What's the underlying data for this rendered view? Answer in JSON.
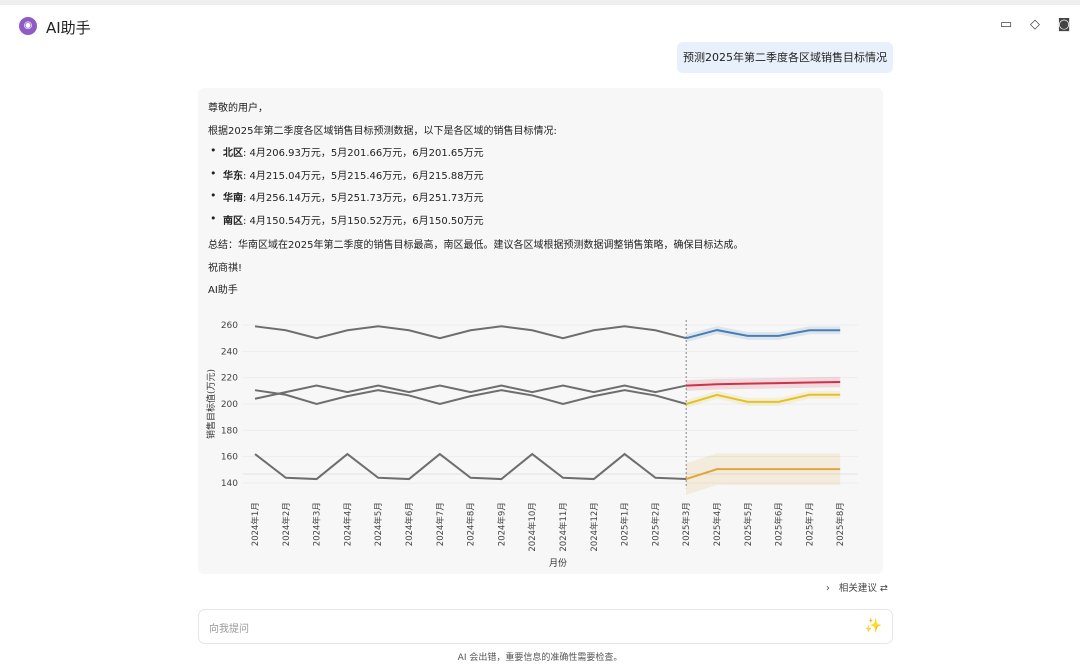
{
  "header": {
    "title": "AI助手",
    "logo_icon": "robot-icon",
    "icons": [
      "feedback-icon",
      "eraser-icon",
      "camera-icon"
    ]
  },
  "user_message": "预测2025年第二季度各区域销售目标情况",
  "answer": {
    "greeting": "尊敬的用户，",
    "intro": "根据2025年第二季度各区域销售目标预测数据，以下是各区域的销售目标情况:",
    "items": [
      {
        "region": "北区",
        "text": ": 4月206.93万元，5月201.66万元，6月201.65万元"
      },
      {
        "region": "华东",
        "text": ": 4月215.04万元，5月215.46万元，6月215.88万元"
      },
      {
        "region": "华南",
        "text": ": 4月256.14万元，5月251.73万元，6月251.73万元"
      },
      {
        "region": "南区",
        "text": ": 4月150.54万元，5月150.52万元，6月150.50万元"
      }
    ],
    "summary": "总结：华南区域在2025年第二季度的销售目标最高，南区最低。建议各区域根据预测数据调整销售策略，确保目标达成。",
    "closing": "祝商祺!",
    "signature": "AI助手"
  },
  "chart_data": {
    "type": "line",
    "xlabel": "月份",
    "ylabel": "销售目标值(万元)",
    "ylim": [
      130,
      265
    ],
    "yticks": [
      140,
      160,
      180,
      200,
      220,
      240,
      260
    ],
    "categories": [
      "2024年1月",
      "2024年2月",
      "2024年3月",
      "2024年4月",
      "2024年5月",
      "2024年6月",
      "2024年7月",
      "2024年8月",
      "2024年9月",
      "2024年10月",
      "2024年11月",
      "2024年12月",
      "2025年1月",
      "2025年2月",
      "2025年3月",
      "2025年4月",
      "2025年5月",
      "2025年6月",
      "2025年7月",
      "2025年8月"
    ],
    "forecast_start_index": 14,
    "series": [
      {
        "name": "华南",
        "history": [
          259,
          256,
          250,
          256,
          259,
          256,
          250,
          256,
          259,
          256,
          250,
          256,
          259,
          256,
          250
        ],
        "forecast": [
          250,
          256.14,
          251.73,
          251.73,
          256,
          256
        ],
        "band": 3,
        "color": "#4a7fb5"
      },
      {
        "name": "华东",
        "history": [
          204,
          209,
          214,
          209,
          214,
          209,
          214,
          209,
          214,
          209,
          214,
          209,
          214,
          209,
          214
        ],
        "forecast": [
          214,
          215.04,
          215.46,
          215.88,
          216.3,
          216.7
        ],
        "band": 4,
        "color": "#d0314a"
      },
      {
        "name": "北区",
        "history": [
          210.5,
          207,
          200,
          206,
          210.5,
          206.5,
          200,
          206,
          210.5,
          206.5,
          200,
          206,
          210.5,
          206.5,
          200
        ],
        "forecast": [
          200,
          206.93,
          201.66,
          201.65,
          207,
          207
        ],
        "band": 3,
        "color": "#e6c02a"
      },
      {
        "name": "南区",
        "history": [
          162,
          144,
          143,
          162,
          144,
          143,
          162,
          144,
          143,
          162,
          144,
          143,
          162,
          144,
          143
        ],
        "forecast": [
          143,
          150.54,
          150.52,
          150.5,
          150.5,
          150.5
        ],
        "band": 12,
        "color": "#e0a63a"
      }
    ],
    "history_color": "#6e6e6e"
  },
  "related_label": "相关建议",
  "input": {
    "placeholder": "向我提问"
  },
  "disclaimer": "AI 会出错，重要信息的准确性需要检查。"
}
